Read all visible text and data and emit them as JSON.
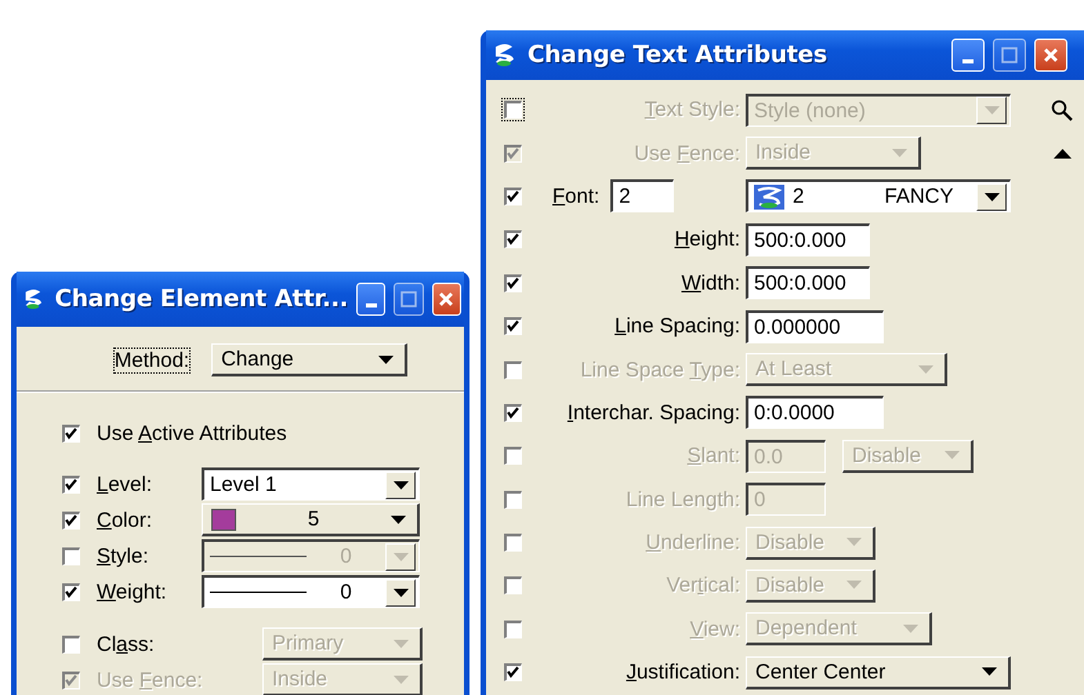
{
  "element_dialog": {
    "title": "Change Element Attr...",
    "method": {
      "label": [
        {
          "text": "Method:",
          "underlined": false
        }
      ],
      "value": "Change",
      "focused": true
    },
    "use_active": {
      "label": [
        {
          "text": "Use ",
          "underlined": false
        },
        {
          "text": "A",
          "underlined": true
        },
        {
          "text": "ctive Attributes",
          "underlined": false
        }
      ],
      "checked": true
    },
    "attribute_rows": [
      {
        "kind": "combo",
        "label": [
          {
            "text": "L",
            "underlined": true
          },
          {
            "text": "evel:",
            "underlined": false
          }
        ],
        "checked": true,
        "disabled": false,
        "label_disabled": false,
        "check_disabled": false,
        "value": "Level 1"
      },
      {
        "kind": "color",
        "label": [
          {
            "text": "C",
            "underlined": true
          },
          {
            "text": "olor:",
            "underlined": false
          }
        ],
        "checked": true,
        "disabled": false,
        "label_disabled": false,
        "check_disabled": false,
        "value": "5",
        "color": "#a43c9c"
      },
      {
        "kind": "line",
        "label": [
          {
            "text": "S",
            "underlined": true
          },
          {
            "text": "tyle:",
            "underlined": false
          }
        ],
        "checked": false,
        "disabled": true,
        "label_disabled": false,
        "check_disabled": false,
        "value": "0"
      },
      {
        "kind": "line",
        "label": [
          {
            "text": "W",
            "underlined": true
          },
          {
            "text": "eight:",
            "underlined": false
          }
        ],
        "checked": true,
        "disabled": false,
        "label_disabled": false,
        "check_disabled": false,
        "value": "0"
      }
    ],
    "option_rows": [
      {
        "kind": "button",
        "label": [
          {
            "text": "Cl",
            "underlined": false
          },
          {
            "text": "a",
            "underlined": true
          },
          {
            "text": "ss:",
            "underlined": false
          }
        ],
        "checked": false,
        "disabled": true,
        "label_disabled": false,
        "check_disabled": false,
        "value": "Primary"
      },
      {
        "kind": "button",
        "label": [
          {
            "text": "Use ",
            "underlined": false
          },
          {
            "text": "F",
            "underlined": true
          },
          {
            "text": "ence:",
            "underlined": false
          }
        ],
        "checked": true,
        "disabled": true,
        "label_disabled": true,
        "check_disabled": true,
        "value": "Inside"
      }
    ]
  },
  "text_dialog": {
    "title": "Change Text Attributes",
    "rows": [
      {
        "kind": "combo",
        "label": [
          {
            "text": "T",
            "underlined": true
          },
          {
            "text": "ext Style:",
            "underlined": false
          }
        ],
        "checked": false,
        "focused": true,
        "disabled": true,
        "label_disabled": true,
        "check_disabled": false,
        "value": "Style (none)",
        "trailing": {
          "kind": "search"
        }
      },
      {
        "kind": "button",
        "label": [
          {
            "text": "Use ",
            "underlined": false
          },
          {
            "text": "F",
            "underlined": true
          },
          {
            "text": "ence:",
            "underlined": false
          }
        ],
        "checked": true,
        "focused": false,
        "disabled": true,
        "label_disabled": true,
        "check_disabled": true,
        "value": "Inside",
        "trailing": {
          "kind": "up"
        }
      },
      {
        "kind": "font",
        "label": [
          {
            "text": "F",
            "underlined": true
          },
          {
            "text": "ont:",
            "underlined": false
          }
        ],
        "checked": true,
        "focused": false,
        "disabled": false,
        "label_disabled": false,
        "check_disabled": false,
        "number": "2",
        "value": "2",
        "font_name": "FANCY"
      },
      {
        "kind": "field",
        "label": [
          {
            "text": "H",
            "underlined": true
          },
          {
            "text": "eight:",
            "underlined": false
          }
        ],
        "checked": true,
        "focused": false,
        "disabled": false,
        "label_disabled": false,
        "check_disabled": false,
        "value": "500:0.000"
      },
      {
        "kind": "field",
        "label": [
          {
            "text": "W",
            "underlined": true
          },
          {
            "text": "idth:",
            "underlined": false
          }
        ],
        "checked": true,
        "focused": false,
        "disabled": false,
        "label_disabled": false,
        "check_disabled": false,
        "value": "500:0.000"
      },
      {
        "kind": "field",
        "label": [
          {
            "text": "L",
            "underlined": true
          },
          {
            "text": "ine Spacing:",
            "underlined": false
          }
        ],
        "checked": true,
        "focused": false,
        "disabled": false,
        "label_disabled": false,
        "check_disabled": false,
        "value": "0.000000"
      },
      {
        "kind": "button",
        "label": [
          {
            "text": "Line Space ",
            "underlined": false
          },
          {
            "text": "T",
            "underlined": true
          },
          {
            "text": "ype:",
            "underlined": false
          }
        ],
        "checked": false,
        "focused": false,
        "disabled": true,
        "label_disabled": true,
        "check_disabled": false,
        "value": "At Least"
      },
      {
        "kind": "field",
        "label": [
          {
            "text": "I",
            "underlined": true
          },
          {
            "text": "nterchar. Spacing:",
            "underlined": false
          }
        ],
        "checked": true,
        "focused": false,
        "disabled": false,
        "label_disabled": false,
        "check_disabled": false,
        "value": "0:0.0000"
      },
      {
        "kind": "field_button",
        "label": [
          {
            "text": "S",
            "underlined": true
          },
          {
            "text": "lant:",
            "underlined": false
          }
        ],
        "checked": false,
        "focused": false,
        "disabled": true,
        "label_disabled": true,
        "check_disabled": false,
        "value": "0.0",
        "option": "Disable"
      },
      {
        "kind": "field",
        "label": [
          {
            "text": "Line Len",
            "underlined": false
          },
          {
            "text": "g",
            "underlined": true
          },
          {
            "text": "th:",
            "underlined": false
          }
        ],
        "checked": false,
        "focused": false,
        "disabled": true,
        "label_disabled": true,
        "check_disabled": false,
        "value": "0"
      },
      {
        "kind": "button",
        "label": [
          {
            "text": "U",
            "underlined": true
          },
          {
            "text": "nderline:",
            "underlined": false
          }
        ],
        "checked": false,
        "focused": false,
        "disabled": true,
        "label_disabled": true,
        "check_disabled": false,
        "value": "Disable"
      },
      {
        "kind": "button",
        "label": [
          {
            "text": "Ver",
            "underlined": false
          },
          {
            "text": "t",
            "underlined": true
          },
          {
            "text": "ical:",
            "underlined": false
          }
        ],
        "checked": false,
        "focused": false,
        "disabled": true,
        "label_disabled": true,
        "check_disabled": false,
        "value": "Disable"
      },
      {
        "kind": "button",
        "label": [
          {
            "text": "V",
            "underlined": true
          },
          {
            "text": "iew:",
            "underlined": false
          }
        ],
        "checked": false,
        "focused": false,
        "disabled": true,
        "label_disabled": true,
        "check_disabled": false,
        "value": "Dependent"
      },
      {
        "kind": "button",
        "label": [
          {
            "text": "J",
            "underlined": true
          },
          {
            "text": "ustification:",
            "underlined": false
          }
        ],
        "checked": true,
        "focused": false,
        "disabled": false,
        "label_disabled": false,
        "check_disabled": false,
        "value": "Center Center"
      }
    ]
  }
}
